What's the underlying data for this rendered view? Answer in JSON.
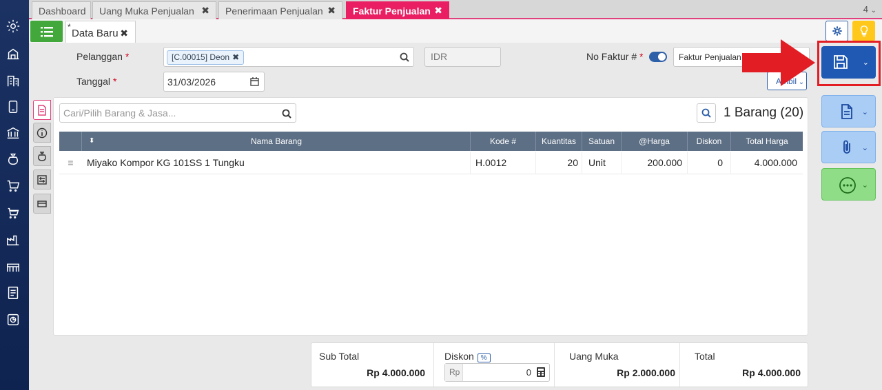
{
  "tabs": [
    {
      "label": "Dashboard"
    },
    {
      "label": "Uang Muka Penjualan"
    },
    {
      "label": "Penerimaan Penjualan"
    },
    {
      "label": "Faktur Penjualan"
    }
  ],
  "tab_count": "4",
  "doc_tab": {
    "star": "*",
    "label": "Data Baru"
  },
  "form": {
    "pelanggan_label": "Pelanggan",
    "pelanggan_chip": "[C.00015] Deon",
    "currency": "IDR",
    "tanggal_label": "Tanggal",
    "tanggal_value": "31/03/2026",
    "no_faktur_label": "No Faktur #",
    "no_faktur_value": "Faktur Penjualan",
    "required_mark": "*",
    "ambil_label": "Ambil"
  },
  "items": {
    "search_placeholder": "Cari/Pilih Barang & Jasa...",
    "count_text": "1 Barang (20)",
    "columns": [
      "Nama Barang",
      "Kode #",
      "Kuantitas",
      "Satuan",
      "@Harga",
      "Diskon",
      "Total Harga"
    ],
    "rows": [
      {
        "name": "Miyako Kompor KG 101SS 1 Tungku",
        "code": "H.0012",
        "qty": "20",
        "unit": "Unit",
        "price": "200.000",
        "discount": "0",
        "total": "4.000.000"
      }
    ]
  },
  "totals": {
    "subtotal_label": "Sub Total",
    "subtotal_value": "Rp 4.000.000",
    "diskon_label": "Diskon",
    "diskon_pct": "%",
    "diskon_prefix": "Rp",
    "diskon_value": "0",
    "uang_muka_label": "Uang Muka",
    "uang_muka_value": "Rp 2.000.000",
    "total_label": "Total",
    "total_value": "Rp 4.000.000"
  },
  "colors": {
    "sidebar": "#1b3263",
    "accent_pink": "#e91e63",
    "primary_blue": "#2059b3",
    "highlight_red": "#e21d24",
    "green": "#43a83b"
  },
  "icons": {
    "sidebar": [
      "gear-icon",
      "inventory-icon",
      "building-icon",
      "device-icon",
      "bank-icon",
      "money-bag-icon",
      "cart-icon",
      "shopping-cart-icon",
      "factory-icon",
      "warehouse-icon",
      "tax-report-icon",
      "dashboard-chart-icon"
    ],
    "toolbar": [
      "list-icon",
      "gear-icon",
      "bulb-icon",
      "save-icon",
      "document-icon",
      "paperclip-icon",
      "more-icon"
    ]
  }
}
